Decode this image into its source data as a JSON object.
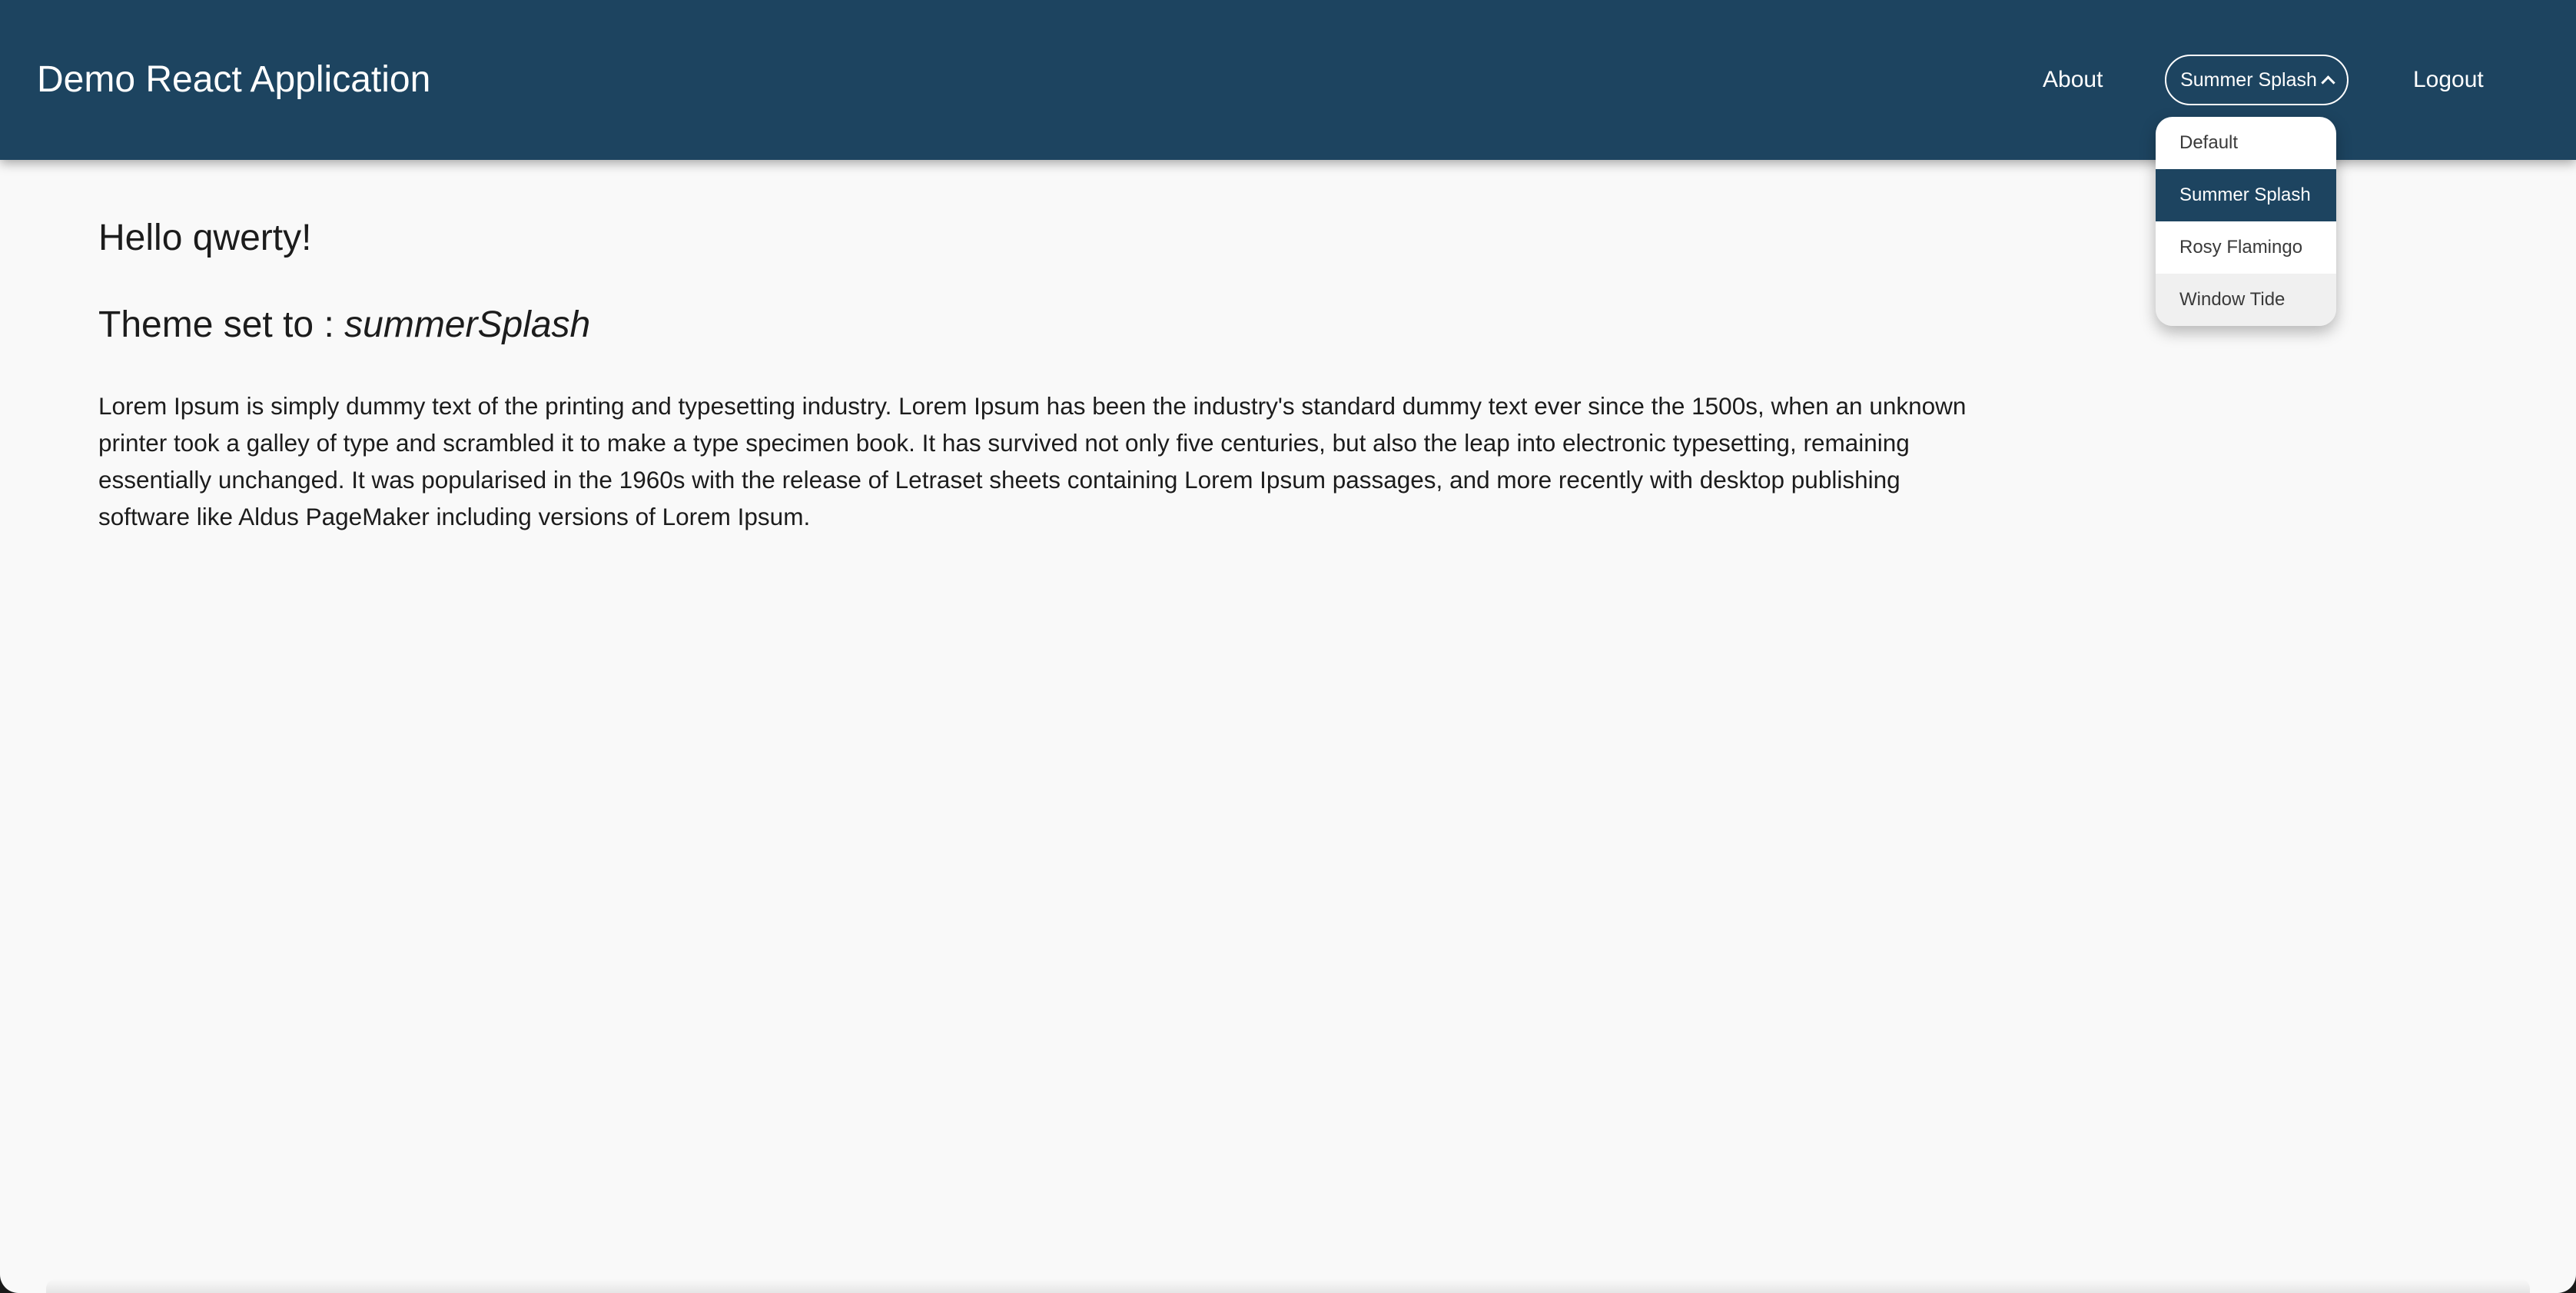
{
  "header": {
    "app_title": "Demo React Application",
    "nav": {
      "about_label": "About",
      "theme_label": "Summer Splash",
      "logout_label": "Logout"
    },
    "accent_color": "#1d4460"
  },
  "theme_menu": {
    "selected": "Summer Splash",
    "options": [
      "Default",
      "Summer Splash",
      "Rosy Flamingo",
      "Window Tide"
    ]
  },
  "main": {
    "greeting": "Hello qwerty!",
    "theme_prefix": "Theme set to : ",
    "theme_value": "summerSplash",
    "paragraph": "Lorem Ipsum is simply dummy text of the printing and typesetting industry. Lorem Ipsum has been the industry's standard dummy text ever since the 1500s, when an unknown printer took a galley of type and scrambled it to make a type specimen book. It has survived not only five centuries, but also the leap into electronic typesetting, remaining essentially unchanged. It was popularised in the 1960s with the release of Letraset sheets containing Lorem Ipsum passages, and more recently with desktop publishing software like Aldus PageMaker including versions of Lorem Ipsum."
  }
}
